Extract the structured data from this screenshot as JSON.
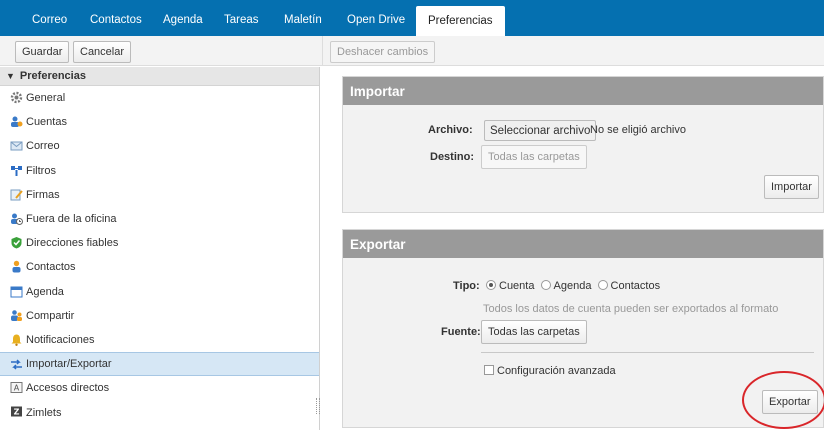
{
  "nav": {
    "tabs": [
      "Correo",
      "Contactos",
      "Agenda",
      "Tareas",
      "Maletín",
      "Open Drive",
      "Preferencias"
    ],
    "active_index": 6
  },
  "toolbar": {
    "save_label": "Guardar",
    "cancel_label": "Cancelar",
    "undo_label": "Deshacer cambios"
  },
  "sidebar": {
    "header": "Preferencias",
    "items": [
      {
        "label": "General",
        "icon": "gear-icon"
      },
      {
        "label": "Cuentas",
        "icon": "accounts-icon"
      },
      {
        "label": "Correo",
        "icon": "mail-icon"
      },
      {
        "label": "Filtros",
        "icon": "filter-icon"
      },
      {
        "label": "Firmas",
        "icon": "signature-icon"
      },
      {
        "label": "Fuera de la oficina",
        "icon": "out-of-office-icon"
      },
      {
        "label": "Direcciones fiables",
        "icon": "shield-check-icon"
      },
      {
        "label": "Contactos",
        "icon": "contact-icon"
      },
      {
        "label": "Agenda",
        "icon": "calendar-icon"
      },
      {
        "label": "Compartir",
        "icon": "share-icon"
      },
      {
        "label": "Notificaciones",
        "icon": "bell-icon"
      },
      {
        "label": "Importar/Exportar",
        "icon": "import-export-icon",
        "selected": true
      },
      {
        "label": "Accesos directos",
        "icon": "shortcut-icon"
      },
      {
        "label": "Zimlets",
        "icon": "zimlet-icon"
      }
    ]
  },
  "importar": {
    "title": "Importar",
    "archivo_label": "Archivo:",
    "file_button": "Seleccionar archivo",
    "file_status": "No se eligió archivo",
    "destino_label": "Destino:",
    "destino_value": "Todas las carpetas",
    "import_button": "Importar"
  },
  "exportar": {
    "title": "Exportar",
    "tipo_label": "Tipo:",
    "options": [
      "Cuenta",
      "Agenda",
      "Contactos"
    ],
    "selected_option": "Cuenta",
    "hint": "Todos los datos de cuenta pueden ser exportados al formato",
    "fuente_label": "Fuente:",
    "fuente_value": "Todas las carpetas",
    "advanced_label": "Configuración avanzada",
    "export_button": "Exportar"
  },
  "colors": {
    "nav_bg": "#0570b0",
    "panel_header": "#9a9a9a",
    "selected_row": "#d6e7f5",
    "highlight_ring": "#d9262a"
  }
}
